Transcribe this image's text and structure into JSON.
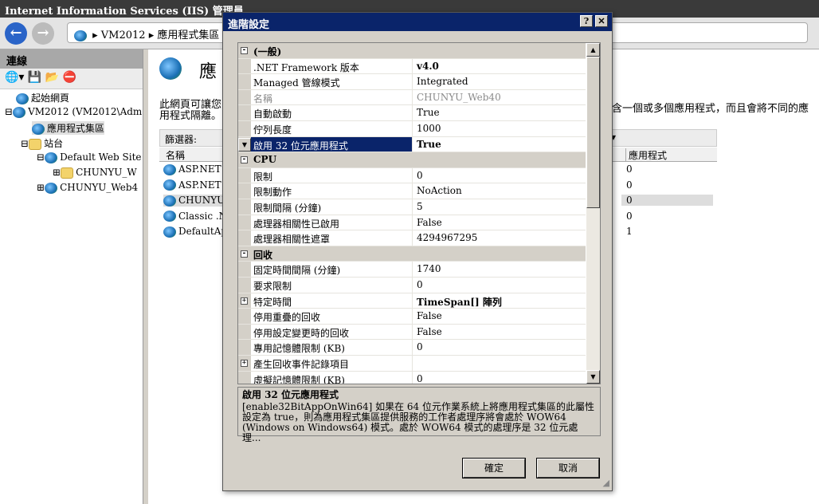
{
  "window": {
    "title": "Internet Information Services (IIS) 管理員"
  },
  "nav": {
    "back_icon": "back-arrow-icon",
    "forward_icon": "forward-arrow-icon",
    "breadcrumb": [
      "VM2012",
      "應用程式集區"
    ]
  },
  "connections": {
    "title": "連線",
    "tree": [
      {
        "label": "起始網頁",
        "level": 0
      },
      {
        "label": "VM2012 (VM2012\\Adm",
        "level": 0,
        "expander": "⊟"
      },
      {
        "label": "應用程式集區",
        "level": 1,
        "selected": true
      },
      {
        "label": "站台",
        "level": 1,
        "expander": "⊟"
      },
      {
        "label": "Default Web Site",
        "level": 2,
        "expander": "⊟"
      },
      {
        "label": "CHUNYU_W",
        "level": 3,
        "expander": "⊞"
      },
      {
        "label": "CHUNYU_Web4",
        "level": 2,
        "expander": "⊞"
      }
    ]
  },
  "main": {
    "title": "應",
    "description": "此網頁可讓您",
    "description2": "用程式隔離。",
    "description_right": "含一個或多個應用程式，而且會將不同的應",
    "filter_label": "篩選器:",
    "columns": {
      "name": "名稱",
      "apps": "應用程式"
    },
    "rows": [
      {
        "name": "ASP.NET",
        "apps": "0"
      },
      {
        "name": "ASP.NET",
        "apps": "0"
      },
      {
        "name": "CHUNYU",
        "apps": "0",
        "selected": true
      },
      {
        "name": "Classic .NI",
        "apps": "0"
      },
      {
        "name": "DefaultAp",
        "apps": "1"
      }
    ]
  },
  "dialog": {
    "title": "進階設定",
    "help": "?",
    "close": "✕",
    "properties": [
      {
        "cat": "(一般)"
      },
      {
        "name": ".NET Framework 版本",
        "value": "v4.0",
        "bold": true
      },
      {
        "name": "Managed 管線模式",
        "value": "Integrated"
      },
      {
        "name": "名稱",
        "value": "CHUNYU_Web40",
        "disabled": true
      },
      {
        "name": "自動啟動",
        "value": "True"
      },
      {
        "name": "佇列長度",
        "value": "1000"
      },
      {
        "name": "啟用 32 位元應用程式",
        "value": "True",
        "selected": true,
        "bold": true
      },
      {
        "cat": "CPU"
      },
      {
        "name": "限制",
        "value": "0"
      },
      {
        "name": "限制動作",
        "value": "NoAction"
      },
      {
        "name": "限制間隔 (分鐘)",
        "value": "5"
      },
      {
        "name": "處理器相關性已啟用",
        "value": "False"
      },
      {
        "name": "處理器相關性遮罩",
        "value": "4294967295"
      },
      {
        "cat": "回收"
      },
      {
        "name": "固定時間間隔 (分鐘)",
        "value": "1740"
      },
      {
        "name": "要求限制",
        "value": "0"
      },
      {
        "name": "特定時間",
        "value": "TimeSpan[] 陣列",
        "bold": true,
        "expander": "⊞"
      },
      {
        "name": "停用重疊的回收",
        "value": "False"
      },
      {
        "name": "停用設定變更時的回收",
        "value": "False"
      },
      {
        "name": "專用記憶體限制 (KB)",
        "value": "0"
      },
      {
        "name": "產生回收事件記錄項目",
        "value": "",
        "expander": "⊞"
      },
      {
        "name": "虛擬記憶體限制 (KB)",
        "value": "0"
      }
    ],
    "desc_title": "啟用 32 位元應用程式",
    "desc_text": "[enable32BitAppOnWin64] 如果在 64 位元作業系統上將應用程式集區的此屬性設定為 true，則為應用程式集區提供服務的工作者處理序將會處於 WOW64 (Windows on Windows64) 模式。處於 WOW64 模式的處理序是 32 位元處理...",
    "ok": "確定",
    "cancel": "取消"
  },
  "colors": {
    "title_bg": "#0a246a",
    "selection": "#0a246a"
  }
}
